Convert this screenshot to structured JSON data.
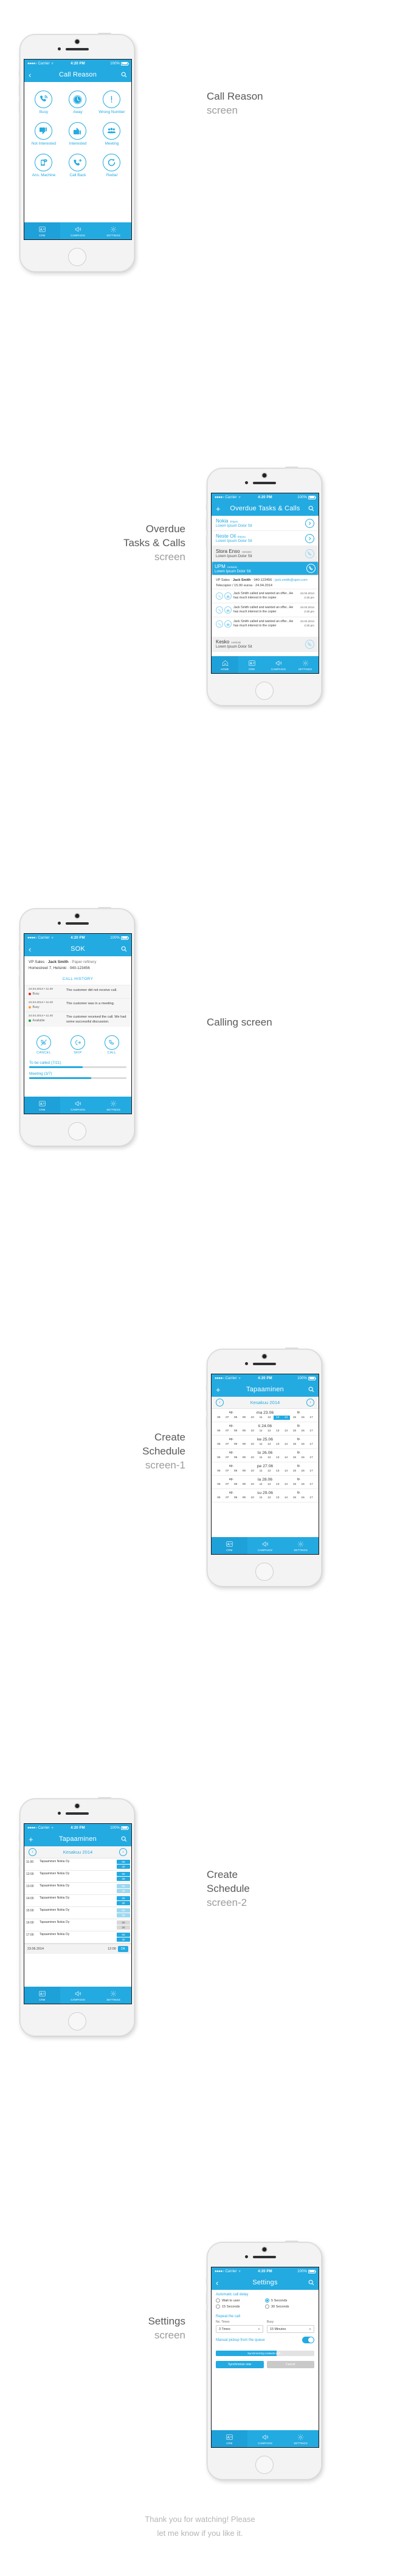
{
  "status_bar": {
    "dots": "●●●●○",
    "carrier": "Carrier",
    "wifi": "wifi-icon",
    "time": "4:20 PM",
    "battery_pct": "100%"
  },
  "tabs": {
    "home": "HOME",
    "crm": "CRM",
    "campaign": "CAMPAIGN",
    "settings": "SETTINGS"
  },
  "colors": {
    "accent": "#23aae1",
    "caption": "#9c9c9c",
    "caption_dark": "#58595b",
    "busy_red": "#e0231f",
    "busy_orange": "#f5a623",
    "available_green": "#14a03c"
  },
  "screens": [
    {
      "caption_lines": [
        "Call Reason",
        "screen"
      ],
      "nav": {
        "left_icon": "chevron-left-icon",
        "title": "Call Reason",
        "right_icon": "search-icon"
      },
      "reasons": [
        {
          "label": "Busy",
          "icon": "phone-ringing-icon"
        },
        {
          "label": "Away",
          "icon": "stopwatch-icon"
        },
        {
          "label": "Wrong Number",
          "icon": "exclamation-icon"
        },
        {
          "label": "Not Interested",
          "icon": "thumbs-down-icon"
        },
        {
          "label": "Interested",
          "icon": "thumbs-up-icon"
        },
        {
          "label": "Meeting",
          "icon": "people-group-icon"
        },
        {
          "label": "Ans. Machine",
          "icon": "answering-machine-icon"
        },
        {
          "label": "Call Back",
          "icon": "phone-forward-icon"
        },
        {
          "label": "Redial",
          "icon": "redial-icon"
        }
      ],
      "tabbar": [
        "CRM",
        "CAMPAIGN",
        "SETTINGS"
      ]
    },
    {
      "caption_lines": [
        "Overdue",
        "Tasks & Calls",
        "screen"
      ],
      "nav": {
        "left_icon": "plus-icon",
        "title": "Overdue Tasks & Calls",
        "right_icon": "search-icon"
      },
      "items": [
        {
          "company": "Nokia",
          "city": "Espoo",
          "sub": "Lorem Ipsum Dolor Sit",
          "style": "blue",
          "right_icon": "chevron-right-icon"
        },
        {
          "company": "Neste Oil",
          "city": "Espoo",
          "sub": "Lorem Ipsum Dolor Sit",
          "style": "blue",
          "right_icon": "chevron-right-icon"
        },
        {
          "company": "Stora Enso",
          "city": "Helsinki",
          "sub": "Lorem Ipsum Dolor Sit",
          "style": "gray",
          "right_icon": "phone-icon"
        },
        {
          "company": "UPM",
          "city": "Helsinki",
          "sub": "Lorem Ipsum Dolor Sit",
          "style": "selected",
          "right_icon": "phone-icon"
        }
      ],
      "detail": {
        "role": "VP Sales",
        "name": "Jack Smith",
        "phone": "040-123456",
        "email": "jack.smith@upm.com",
        "line2": "Telecopier / 15.00 euroa  ·  24.04.2014"
      },
      "notes": [
        {
          "icon_a": "phone-icon",
          "icon_b": "thumbs-up-icon",
          "text": "Jack Smith called and wanted an offer...He has much interest in the copier",
          "date": "24.04.2014",
          "time": "2:30 pm"
        },
        {
          "icon_a": "phone-icon",
          "icon_b": "thumbs-up-icon",
          "text": "Jack Smith called and wanted an offer...He has much interest in the copier",
          "date": "24.04.2014",
          "time": "2:30 pm"
        },
        {
          "icon_a": "phone-ringing-icon",
          "icon_b": "thumbs-up-icon",
          "text": "Jack Smith called and wanted an offer...He has much interest in the copier",
          "date": "24.04.2014",
          "time": "2:30 pm"
        }
      ],
      "last_item": {
        "company": "Kesko",
        "city": "Helsinki",
        "sub": "Lorem Ipsum Dolor Sit",
        "style": "gray",
        "right_icon": "phone-icon"
      },
      "tabbar": [
        "HOME",
        "CRM",
        "CAMPAIGN",
        "SETTINGS"
      ]
    },
    {
      "caption_lines": [
        "Calling screen"
      ],
      "nav": {
        "left_icon": "chevron-left-icon",
        "title": "SOK",
        "right_icon": "search-icon"
      },
      "contact": {
        "role": "VP Sales",
        "name": "Jack Smith",
        "company": "Paper refinery",
        "address": "Homestreet 7, Helsinki  ·  040-123456"
      },
      "call_history_label": "CALL HISTORY",
      "history": [
        {
          "datetime": "24.04.2014 • 11:40",
          "status": "Busy",
          "status_color": "#e0231f",
          "desc": "The customer did not receive call."
        },
        {
          "datetime": "24.04.2014 • 11:40",
          "status": "Busy",
          "status_color": "#f5a623",
          "desc": "The customer was in a meeting."
        },
        {
          "datetime": "24.04.2014 • 11:40",
          "status": "Available",
          "status_color": "#14a03c",
          "desc": "The customer received the call. We had some successful discussion."
        }
      ],
      "actions": [
        {
          "label": "CANCEL",
          "icon": "phone-cancel-icon"
        },
        {
          "label": "SKIP",
          "icon": "phone-skip-icon"
        },
        {
          "label": "CALL",
          "icon": "phone-icon"
        }
      ],
      "progress": [
        {
          "label": "To be called (7/21)",
          "pct": 55
        },
        {
          "label": "Meeting (3/7)",
          "pct": 64
        }
      ],
      "tabbar": [
        "CRM",
        "CAMPAIGN",
        "SETTINGS"
      ]
    },
    {
      "caption_lines": [
        "Create",
        "Schedule",
        "screen-1"
      ],
      "nav": {
        "left_icon": "plus-icon",
        "title": "Tapaaminen",
        "right_icon": "search-icon"
      },
      "month": {
        "prev_icon": "chevron-left-circle-icon",
        "name": "Kesakuu 2014",
        "next_icon": "chevron-right-circle-icon"
      },
      "am_label": "ap.",
      "pm_label": "ip.",
      "am_hours": [
        "06",
        "07",
        "08",
        "09",
        "10",
        "11"
      ],
      "pm_hours": [
        "12",
        "13",
        "14",
        "15",
        "16",
        "17"
      ],
      "days": [
        {
          "name": "ma 23.06",
          "selected": [
            "13",
            "14"
          ]
        },
        {
          "name": "ti 24.06",
          "selected": []
        },
        {
          "name": "ke 25.06",
          "selected": []
        },
        {
          "name": "to 26.06",
          "selected": []
        },
        {
          "name": "pe 27.06",
          "selected": []
        },
        {
          "name": "la 28.06",
          "selected": []
        },
        {
          "name": "su 29.06",
          "selected": []
        }
      ],
      "tabbar": [
        "CRM",
        "CAMPAIGN",
        "SETTINGS"
      ]
    },
    {
      "caption_lines": [
        "Create",
        "Schedule",
        "screen-2"
      ],
      "nav": {
        "left_icon": "plus-icon",
        "title": "Tapaaminen",
        "right_icon": "search-icon"
      },
      "month": {
        "prev_icon": "chevron-left-circle-icon",
        "name": "Kesakuu 2014",
        "next_icon": "chevron-right-circle-icon"
      },
      "rows": [
        {
          "time": "11:00",
          "title": "Tapaaminen Nokia Oy",
          "chips": [
            "00",
            "30"
          ],
          "chip_style": "solid"
        },
        {
          "time": "12:00",
          "title": "Tapaaminen Nokia Oy",
          "chips": [
            "00",
            "30"
          ],
          "chip_style": "solid"
        },
        {
          "time": "13:00",
          "title": "Tapaaminen Nokia Oy",
          "chips": [
            "00",
            "30"
          ],
          "chip_style": "lite"
        },
        {
          "time": "14:00",
          "title": "Tapaaminen Nokia Oy",
          "chips": [
            "00",
            "30"
          ],
          "chip_style": "solid"
        },
        {
          "time": "15:00",
          "title": "Tapaaminen Nokia Oy",
          "chips": [
            "00",
            "30"
          ],
          "chip_style": "lite"
        },
        {
          "time": "16:00",
          "title": "Tapaaminen Nokia Oy",
          "chips": [
            "00",
            "30"
          ],
          "chip_style": "gray"
        },
        {
          "time": "17:00",
          "title": "Tapaaminen Nokia Oy",
          "chips": [
            "00",
            "30"
          ],
          "chip_style": "solid"
        }
      ],
      "footer": {
        "ok": "OK",
        "date": "23.06.2014",
        "time": "12:00"
      },
      "tabbar": [
        "CRM",
        "CAMPAIGN",
        "SETTINGS"
      ]
    },
    {
      "caption_lines": [
        "Settings",
        "screen"
      ],
      "nav": {
        "left_icon": "chevron-left-icon",
        "title": "Settings",
        "right_icon": "search-icon"
      },
      "delay": {
        "header": "Automatic call delay",
        "options": [
          {
            "label": "Wait to user",
            "checked": false
          },
          {
            "label": "5 Seconds",
            "checked": true
          },
          {
            "label": "15 Seconds",
            "checked": false
          },
          {
            "label": "30 Seconds",
            "checked": false
          }
        ]
      },
      "repeat": {
        "header": "Repeat the call",
        "fields": [
          {
            "label": "No. Times",
            "value": "3 Times",
            "caret": "chevron-down-icon"
          },
          {
            "label": "Busy",
            "value": "15 Minutes",
            "caret": "chevron-down-icon"
          }
        ]
      },
      "manual": {
        "label": "Manual pickup from the queue",
        "toggle": "on"
      },
      "sync": {
        "label": "Synchronizing contacts with...",
        "pct": 62
      },
      "buttons": [
        {
          "label": "Synchronize now",
          "style": "solid"
        },
        {
          "label": "Cancel",
          "style": "gray"
        }
      ],
      "tabbar": [
        "CRM",
        "CAMPAIGN",
        "SETTINGS"
      ]
    }
  ],
  "footer": {
    "line1": "Thank you for watching! Please",
    "line2": "let me know if you like it."
  }
}
